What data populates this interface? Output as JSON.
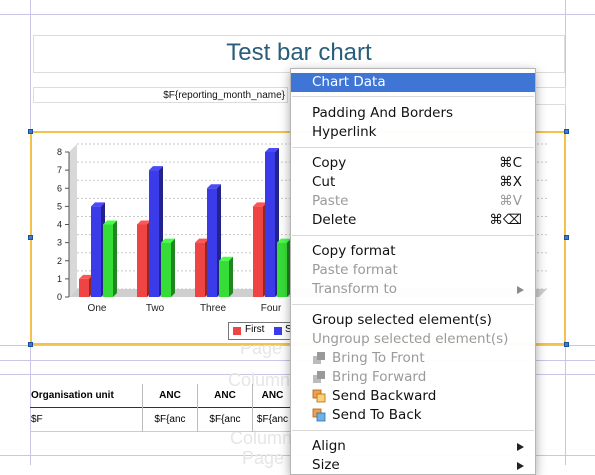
{
  "report": {
    "title": "Test bar chart",
    "subtitle_field": "$F{reporting_month_name}",
    "faint_labels": [
      "Page",
      "Column",
      "Column",
      "Page"
    ]
  },
  "chart_data": {
    "type": "bar",
    "title": "",
    "categories": [
      "One",
      "Two",
      "Three",
      "Four"
    ],
    "series": [
      {
        "name": "First",
        "values": [
          1,
          4,
          3,
          5
        ],
        "color": "#ef4444"
      },
      {
        "name": "S",
        "values": [
          5,
          7,
          6,
          8
        ],
        "color": "#3b3bea"
      },
      {
        "name": "",
        "values": [
          4,
          3,
          2,
          3
        ],
        "color": "#37dd37"
      }
    ],
    "y_ticks": [
      "0",
      "1",
      "2",
      "3",
      "4",
      "5",
      "6",
      "7",
      "8"
    ],
    "ylim": [
      0,
      8
    ],
    "grid": true,
    "legend_position": "bottom"
  },
  "table": {
    "headers": [
      "Organisation unit",
      "ANC",
      "ANC",
      "ANC"
    ],
    "row": [
      "$F",
      "$F{anc",
      "$F{anc",
      "$F{anc"
    ]
  },
  "context_menu": {
    "items": {
      "chart_data": "Chart Data",
      "padding_borders": "Padding And Borders",
      "hyperlink": "Hyperlink",
      "copy": "Copy",
      "copy_sc": "⌘C",
      "cut": "Cut",
      "cut_sc": "⌘X",
      "paste": "Paste",
      "paste_sc": "⌘V",
      "delete": "Delete",
      "delete_sc": "⌘⌫",
      "copy_format": "Copy format",
      "paste_format": "Paste format",
      "transform_to": "Transform to",
      "group": "Group selected element(s)",
      "ungroup": "Ungroup selected element(s)",
      "bring_front": "Bring To Front",
      "bring_forward": "Bring Forward",
      "send_backward": "Send Backward",
      "send_back": "Send To Back",
      "align": "Align",
      "size": "Size"
    }
  },
  "colors": {
    "highlight": "#3f76d6",
    "selection": "#f2c34b",
    "title": "#2a5d7a"
  }
}
